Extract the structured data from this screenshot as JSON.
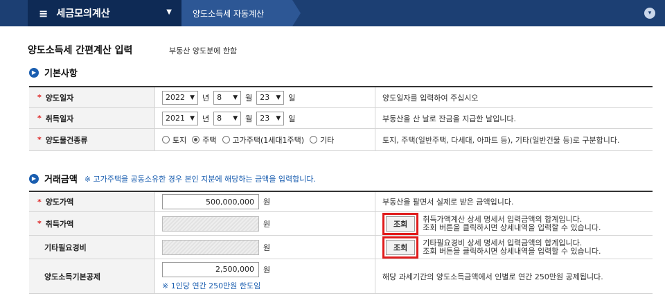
{
  "nav": {
    "menu_label": "세금모의계산",
    "breadcrumb": "양도소득세 자동계산"
  },
  "page": {
    "title": "양도소득세 간편계산 입력",
    "subtitle": "부동산 양도분에 한함"
  },
  "basic": {
    "title": "기본사항",
    "rows": [
      {
        "label": "양도일자",
        "year": "2022",
        "month": "8",
        "day": "23",
        "desc": "양도일자를 입력하여 주십시오"
      },
      {
        "label": "취득일자",
        "year": "2021",
        "month": "8",
        "day": "23",
        "desc": "부동산을 산 날로 잔금을 지급한 날입니다."
      }
    ],
    "unit_year": "년",
    "unit_month": "월",
    "unit_day": "일",
    "type_row": {
      "label": "양도물건종류",
      "options": [
        "토지",
        "주택",
        "고가주택(1세대1주택)",
        "기타"
      ],
      "selected": "주택",
      "desc": "토지, 주택(일반주택, 다세대, 아파트 등), 기타(일반건물 등)로 구분합니다."
    }
  },
  "amount": {
    "title": "거래금액",
    "note": "※ 고가주택을 공동소유한 경우 본인 지분에 해당하는 금액을 입력합니다.",
    "unit": "원",
    "btn_label": "조회",
    "rows": [
      {
        "label": "양도가액",
        "required": true,
        "value": "500,000,000",
        "desc": "부동산을 팔면서 실제로 받은 금액입니다."
      },
      {
        "label": "취득가액",
        "required": true,
        "value": "",
        "desc1": "취득가액계산 상세 명세서 입력금액의 합계입니다.",
        "desc2": "조회 버튼을 클릭하시면 상세내역을 입력할 수 있습니다."
      },
      {
        "label": "기타필요경비",
        "required": false,
        "value": "",
        "desc1": "기타필요경비 상세 명세서 입력금액의 합계입니다.",
        "desc2": "조회 버튼을 클릭하시면 상세내역을 입력할 수 있습니다."
      },
      {
        "label": "양도소득기본공제",
        "required": false,
        "value": "2,500,000",
        "note": "※ 1인당 연간 250만원 한도임",
        "desc": "해당 과세기간의 양도소득금액에서 인별로 연간 250만원 공제됩니다."
      }
    ]
  }
}
